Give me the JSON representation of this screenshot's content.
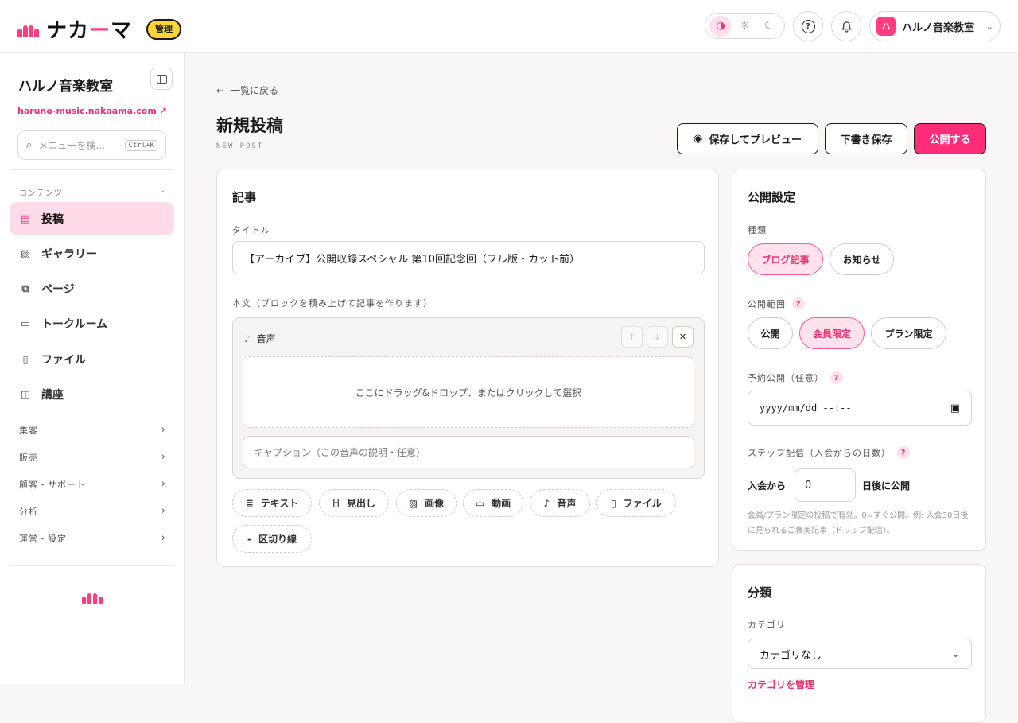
{
  "header": {
    "logo_text_a": "ナカ",
    "logo_text_dash": "ー",
    "logo_text_b": "マ",
    "admin_badge": "管理",
    "account_avatar": "ハ",
    "account_name": "ハルノ音楽教室",
    "icons": [
      "contrast-icon",
      "sun-icon",
      "moon-icon",
      "help-icon",
      "bell-icon",
      "chevron-down-icon"
    ]
  },
  "sidebar": {
    "title": "ハルノ音楽教室",
    "url": "haruno-music.nakaama.com",
    "search_placeholder": "メニューを検…",
    "search_kbd": "Ctrl+K",
    "section_label": "コンテンツ",
    "items": [
      {
        "label": "投稿",
        "icon": "document-icon",
        "active": true
      },
      {
        "label": "ギャラリー",
        "icon": "image-icon"
      },
      {
        "label": "ページ",
        "icon": "pages-icon"
      },
      {
        "label": "トークルーム",
        "icon": "chat-icon"
      },
      {
        "label": "ファイル",
        "icon": "file-icon"
      },
      {
        "label": "講座",
        "icon": "book-icon"
      }
    ],
    "groups": [
      "集客",
      "販売",
      "顧客・サポート",
      "分析",
      "運営・設定"
    ]
  },
  "page": {
    "back_label": "一覧に戻る",
    "title": "新規投稿",
    "subtitle": "NEW POST",
    "preview_button": "保存してプレビュー",
    "draft_button": "下書き保存",
    "publish_button": "公開する"
  },
  "article": {
    "card_title": "記事",
    "title_label": "タイトル",
    "title_value": "【アーカイブ】公開収録スペシャル 第10回記念回（フル版・カット前）",
    "body_label": "本文（ブロックを積み上げて記事を作ります）",
    "block_type": "音声",
    "drop_text": "ここにドラッグ&ドロップ、またはクリックして選択",
    "caption_placeholder": "キャプション（この音声の説明・任意）",
    "add_blocks": [
      {
        "label": "テキスト",
        "icon": "text-icon"
      },
      {
        "label": "見出し",
        "icon": "heading-icon"
      },
      {
        "label": "画像",
        "icon": "image-icon"
      },
      {
        "label": "動画",
        "icon": "video-icon"
      },
      {
        "label": "音声",
        "icon": "mic-icon"
      },
      {
        "label": "ファイル",
        "icon": "file-icon"
      },
      {
        "label": "区切り線",
        "icon": "divider-icon"
      }
    ]
  },
  "publish": {
    "card_title": "公開設定",
    "type_label": "種類",
    "type_options": [
      "ブログ記事",
      "お知らせ"
    ],
    "type_selected": "ブログ記事",
    "scope_label": "公開範囲",
    "scope_options": [
      "公開",
      "会員限定",
      "プラン限定"
    ],
    "scope_selected": "会員限定",
    "schedule_label": "予約公開（任意）",
    "schedule_placeholder": "yyyy/mm/dd --:--",
    "step_label": "ステップ配信（入会からの日数）",
    "step_prefix": "入会から",
    "step_value": "0",
    "step_suffix": "日後に公開",
    "note": "会員/プラン限定の投稿で有効。0=すぐ公開。例: 入会30日後に見られるご褒美記事（ドリップ配信）。"
  },
  "classify": {
    "card_title": "分類",
    "category_label": "カテゴリ",
    "category_value": "カテゴリなし",
    "manage_link": "カテゴリを管理"
  },
  "colors": {
    "accent": "#ff2d78",
    "accent_soft": "#ffdae8",
    "badge": "#ffd43b"
  }
}
